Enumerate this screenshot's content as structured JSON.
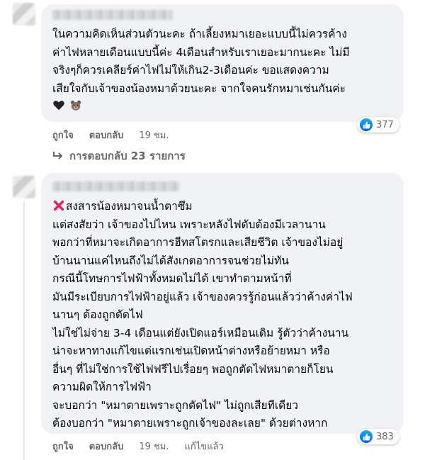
{
  "comment1": {
    "lines": [
      "ในความคิดเห็นส่วนตัวนะคะ ถ้าเลี้ยงหมาเยอะแบบนี้ไม่ควรค้าง",
      "ค่าไฟหลายเดือนแบบนี้ค่ะ 4เดือนสำหรับเราเยอะมากนะคะ ไม่มี",
      "จริงๆก็ควรเคลียร์ค่าไฟไม่ให้เกิน2-3เดือนค่ะ ขอแสดงความ",
      "เสียใจกับเจ้าของน้องหมาด้วยนะคะ จากใจคนรักหมาเช่นกันค่ะ"
    ],
    "emoji_line_icons": [
      "black-heart-icon",
      "bear-icon"
    ],
    "reaction_count": "377",
    "actions": {
      "like": "ถูกใจ",
      "reply": "ตอบกลับ",
      "time": "19 ชม."
    },
    "replies_label": "การตอบกลับ 23 รายการ"
  },
  "comment2": {
    "first_line": "สงสารน้องหมาจนน้ำตาซึม",
    "lines": [
      "แต่สงสัยว่า เจ้าของไปไหน เพราะหลังไฟดับต้องมีเวลานาน",
      "พอกว่าที่หมาจะเกิดอาการฮีทสโตรกและเสียชีวิต เจ้าของไม่อยู่",
      "บ้านนานแค่ไหนถึงไม่ได้สังเกตอาการจนช่วยไม่ทัน",
      "กรณีนี้โทษการไฟฟ้าทั้งหมดไม่ได้ เขาทำตามหน้าที่",
      "มันมีระเบียบการไฟฟ้าอยู่แล้ว เจ้าของควรรู้ก่อนแล้วว่าค้างค่าไฟ",
      "นานๆ ต้องถูกตัดไฟ",
      "ไม่ใช่ไม่จ่าย 3-4 เดือนแต่ยังเปิดแอร์เหมือนเดิม รู้ตัวว่าค้างนาน",
      "น่าจะหาทางแก้ไขแต่แรกเช่นเปิดหน้าต่างหรือย้ายหมา หรือ",
      "อื่นๆ ที่ไม่ใช่การใช้ไฟฟรีไปเรื่อยๆ พอถูกตัดไฟหมาตายก็โยน",
      "ความผิดให้การไฟฟ้า",
      "จะบอกว่า \"หมาตายเพราะถูกตัดไฟ\" ไม่ถูกเสียทีเดียว",
      "ต้องบอกว่า \"หมาตายเพราะถูกเจ้าของละเลย\" ด้วยต่างหาก"
    ],
    "reaction_count": "383",
    "actions": {
      "like": "ถูกใจ",
      "reply": "ตอบกลับ",
      "time": "19 ชม.",
      "edited": "แก้ไขแล้ว"
    }
  },
  "colors": {
    "bubble": "#f0f2f5",
    "muted": "#65676b",
    "like_blue": "#0866ff",
    "cross_red": "#e0245e"
  }
}
